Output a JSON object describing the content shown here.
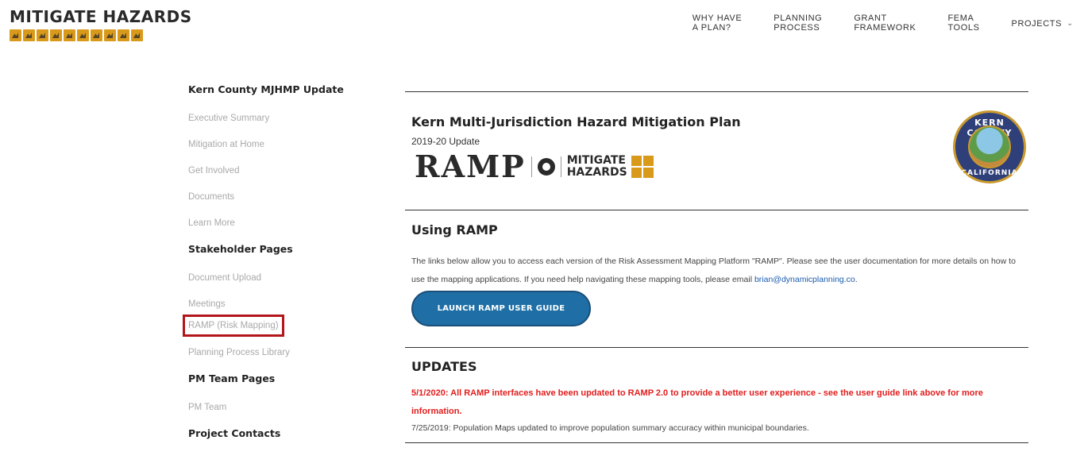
{
  "header": {
    "logo_text": "MITIGATE HAZARDS",
    "nav": [
      {
        "label": "WHY HAVE\nA PLAN?"
      },
      {
        "label": "PLANNING\nPROCESS"
      },
      {
        "label": "GRANT\nFRAMEWORK"
      },
      {
        "label": "FEMA\nTOOLS"
      },
      {
        "label": "PROJECTS"
      }
    ]
  },
  "sidebar": {
    "section1": {
      "heading": "Kern County MJHMP Update",
      "links": [
        "Executive Summary",
        "Mitigation at Home",
        "Get Involved",
        "Documents",
        "Learn More"
      ]
    },
    "section2": {
      "heading": "Stakeholder Pages",
      "links": [
        "Document Upload",
        "Meetings",
        "RAMP (Risk Mapping)",
        "Planning Process Library"
      ]
    },
    "section3": {
      "heading": "PM Team Pages",
      "links": [
        "PM Team"
      ]
    },
    "section4": {
      "heading": "Project Contacts"
    }
  },
  "main": {
    "plan_title": "Kern Multi-Jurisdiction Hazard Mitigation Plan",
    "plan_subtitle": "2019-20 Update",
    "ramp_logo_text": "RAMP",
    "mh_logo_line1": "MITIGATE",
    "mh_logo_line2": "HAZARDS",
    "seal_top": "KERN COUNTY",
    "seal_bottom": "CALIFORNIA",
    "using_heading": "Using RAMP",
    "using_text": "The links below allow you to access each version of the Risk Assessment Mapping Platform \"RAMP\". Please see the user documentation for more details on how to use the mapping applications. If you need help navigating these mapping tools, please email ",
    "using_email": "brian@dynamicplanning.co",
    "button_label": "LAUNCH RAMP USER GUIDE",
    "updates_heading": "UPDATES",
    "update_red": "5/1/2020: All RAMP interfaces have been updated to RAMP 2.0 to provide a better user experience - see the user guide link above for more information.",
    "update_normal": "7/25/2019: Population Maps updated to improve population summary accuracy within municipal boundaries."
  },
  "colors": {
    "accent": "#d99a1c",
    "button": "#1f6fa6",
    "highlight_box": "#b2161b",
    "update_red": "#e21d1d"
  }
}
